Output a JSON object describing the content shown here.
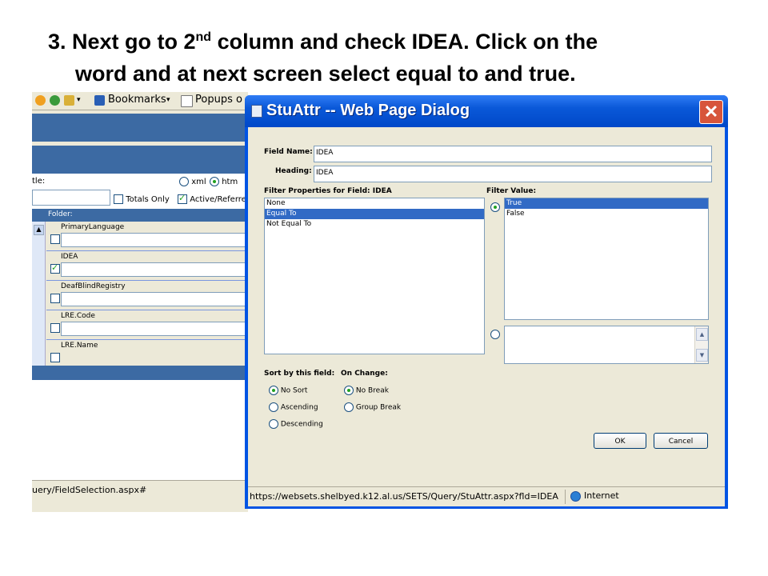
{
  "heading": {
    "prefix": "3. Next go to 2",
    "sup": "nd",
    "rest": " column and check IDEA. Click on the",
    "line2": "word and at next screen select equal to and true."
  },
  "background_window": {
    "toolbar": {
      "bookmarks": "Bookmarks",
      "popups": "Popups o"
    },
    "title_label": "tle:",
    "format_options": [
      "xml",
      "htm"
    ],
    "totals_only": "Totals Only",
    "active_referred": "Active/Referre",
    "folder_label": "Folder:",
    "fields": [
      {
        "name": "PrimaryLanguage",
        "checked": false
      },
      {
        "name": "IDEA",
        "checked": true
      },
      {
        "name": "DeafBlindRegistry",
        "checked": false
      },
      {
        "name": "LRE.Code",
        "checked": false
      },
      {
        "name": "LRE.Name",
        "checked": false
      }
    ],
    "status_url": "uery/FieldSelection.aspx#"
  },
  "dialog": {
    "title": "StuAttr -- Web Page Dialog",
    "field_name_label": "Field Name:",
    "field_name_value": "IDEA",
    "heading_label": "Heading:",
    "heading_value": "IDEA",
    "filter_properties_label": "Filter Properties for Field: IDEA",
    "filter_properties": [
      "None",
      "Equal To",
      "Not Equal To"
    ],
    "filter_properties_selected": "Equal To",
    "filter_value_label": "Filter Value:",
    "filter_values": [
      "True",
      "False"
    ],
    "filter_values_selected": "True",
    "sort_label": "Sort by this field:",
    "sort_options": [
      "No Sort",
      "Ascending",
      "Descending"
    ],
    "sort_selected": "No Sort",
    "onchange_label": "On Change:",
    "onchange_options": [
      "No Break",
      "Group Break"
    ],
    "onchange_selected": "No Break",
    "ok_label": "OK",
    "cancel_label": "Cancel",
    "status_url": "https://websets.shelbyed.k12.al.us/SETS/Query/StuAttr.aspx?fld=IDEA&",
    "status_zone": "Internet"
  }
}
